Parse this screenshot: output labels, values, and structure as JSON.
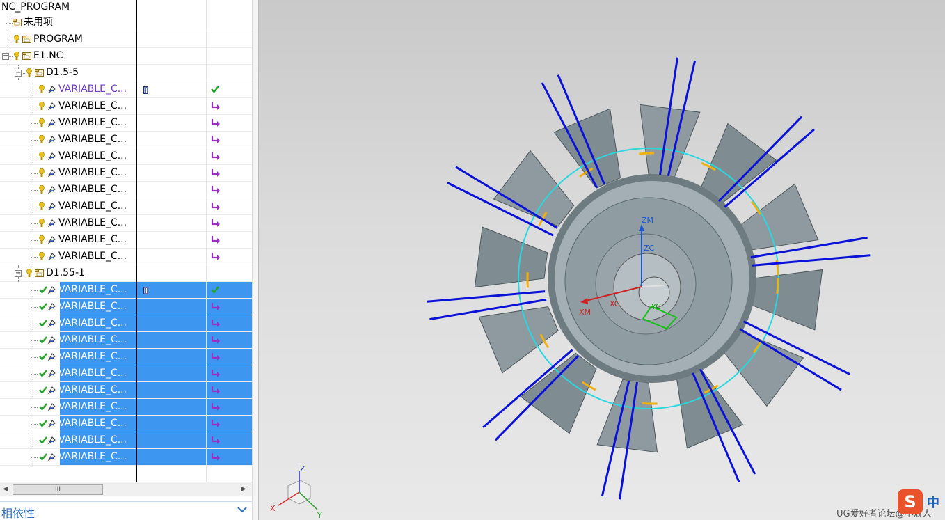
{
  "navigator": {
    "root_label": "NC_PROGRAM",
    "rows": [
      {
        "label": "未用项",
        "indent": 1,
        "kind": "group",
        "status": ""
      },
      {
        "label": "PROGRAM",
        "indent": 1,
        "kind": "program",
        "status": "warn"
      },
      {
        "label": "E1.NC",
        "indent": 1,
        "kind": "program",
        "status": "warn",
        "expanded": true
      },
      {
        "label": "D1.5-5",
        "indent": 2,
        "kind": "program",
        "status": "warn",
        "expanded": true
      },
      {
        "label": "VARIABLE_C...",
        "indent": 3,
        "kind": "op",
        "status": "warn",
        "text_color": "#6f3bbf",
        "col2": "toolpath",
        "col3": "check"
      },
      {
        "label": "VARIABLE_C...",
        "indent": 3,
        "kind": "op",
        "status": "warn",
        "col3": "regen"
      },
      {
        "label": "VARIABLE_C...",
        "indent": 3,
        "kind": "op",
        "status": "warn",
        "col3": "regen"
      },
      {
        "label": "VARIABLE_C...",
        "indent": 3,
        "kind": "op",
        "status": "warn",
        "col3": "regen"
      },
      {
        "label": "VARIABLE_C...",
        "indent": 3,
        "kind": "op",
        "status": "warn",
        "col3": "regen"
      },
      {
        "label": "VARIABLE_C...",
        "indent": 3,
        "kind": "op",
        "status": "warn",
        "col3": "regen"
      },
      {
        "label": "VARIABLE_C...",
        "indent": 3,
        "kind": "op",
        "status": "warn",
        "col3": "regen"
      },
      {
        "label": "VARIABLE_C...",
        "indent": 3,
        "kind": "op",
        "status": "warn",
        "col3": "regen"
      },
      {
        "label": "VARIABLE_C...",
        "indent": 3,
        "kind": "op",
        "status": "warn",
        "col3": "regen"
      },
      {
        "label": "VARIABLE_C...",
        "indent": 3,
        "kind": "op",
        "status": "warn",
        "col3": "regen"
      },
      {
        "label": "VARIABLE_C...",
        "indent": 3,
        "kind": "op",
        "status": "warn",
        "col3": "regen"
      },
      {
        "label": "D1.55-1",
        "indent": 2,
        "kind": "program",
        "status": "warn",
        "expanded": true
      },
      {
        "label": "VARIABLE_C...",
        "indent": 3,
        "kind": "op",
        "status": "ok",
        "selected": true,
        "col2": "toolpath",
        "col3": "check"
      },
      {
        "label": "VARIABLE_C...",
        "indent": 3,
        "kind": "op",
        "status": "ok",
        "selected": true,
        "col3": "regen"
      },
      {
        "label": "VARIABLE_C...",
        "indent": 3,
        "kind": "op",
        "status": "ok",
        "selected": true,
        "col3": "regen"
      },
      {
        "label": "VARIABLE_C...",
        "indent": 3,
        "kind": "op",
        "status": "ok",
        "selected": true,
        "col3": "regen"
      },
      {
        "label": "VARIABLE_C...",
        "indent": 3,
        "kind": "op",
        "status": "ok",
        "selected": true,
        "col3": "regen"
      },
      {
        "label": "VARIABLE_C...",
        "indent": 3,
        "kind": "op",
        "status": "ok",
        "selected": true,
        "col3": "regen"
      },
      {
        "label": "VARIABLE_C...",
        "indent": 3,
        "kind": "op",
        "status": "ok",
        "selected": true,
        "col3": "regen"
      },
      {
        "label": "VARIABLE_C...",
        "indent": 3,
        "kind": "op",
        "status": "ok",
        "selected": true,
        "col3": "regen"
      },
      {
        "label": "VARIABLE_C...",
        "indent": 3,
        "kind": "op",
        "status": "ok",
        "selected": true,
        "col3": "regen"
      },
      {
        "label": "VARIABLE_C...",
        "indent": 3,
        "kind": "op",
        "status": "ok",
        "selected": true,
        "col3": "regen"
      },
      {
        "label": "VARIABLE_C...",
        "indent": 3,
        "kind": "op",
        "status": "ok",
        "selected": true,
        "col3": "regen"
      }
    ],
    "hscroll_thumb_label": "III",
    "dependencies_label": "相依性",
    "colors": {
      "selection": "#3d97f0",
      "warn": "#e8c320",
      "ok": "#22a622",
      "regen": "#9a2fc4",
      "accent": "#2a6fb8"
    }
  },
  "viewport": {
    "wcs_labels": {
      "zm": "ZM",
      "zc": "ZC",
      "xm": "XM",
      "xc": "XC",
      "yc": "YC"
    },
    "triad_labels": {
      "x": "X",
      "y": "Y",
      "z": "Z"
    },
    "colors": {
      "tool_axis": "#0a12d8",
      "blade": "#8e9aa0",
      "boundary": "#28d8e0",
      "cut": "#f0b010"
    },
    "watermark": "UG爱好者论坛@小浪人",
    "ime_logo": "S",
    "ime_mode": "中"
  }
}
